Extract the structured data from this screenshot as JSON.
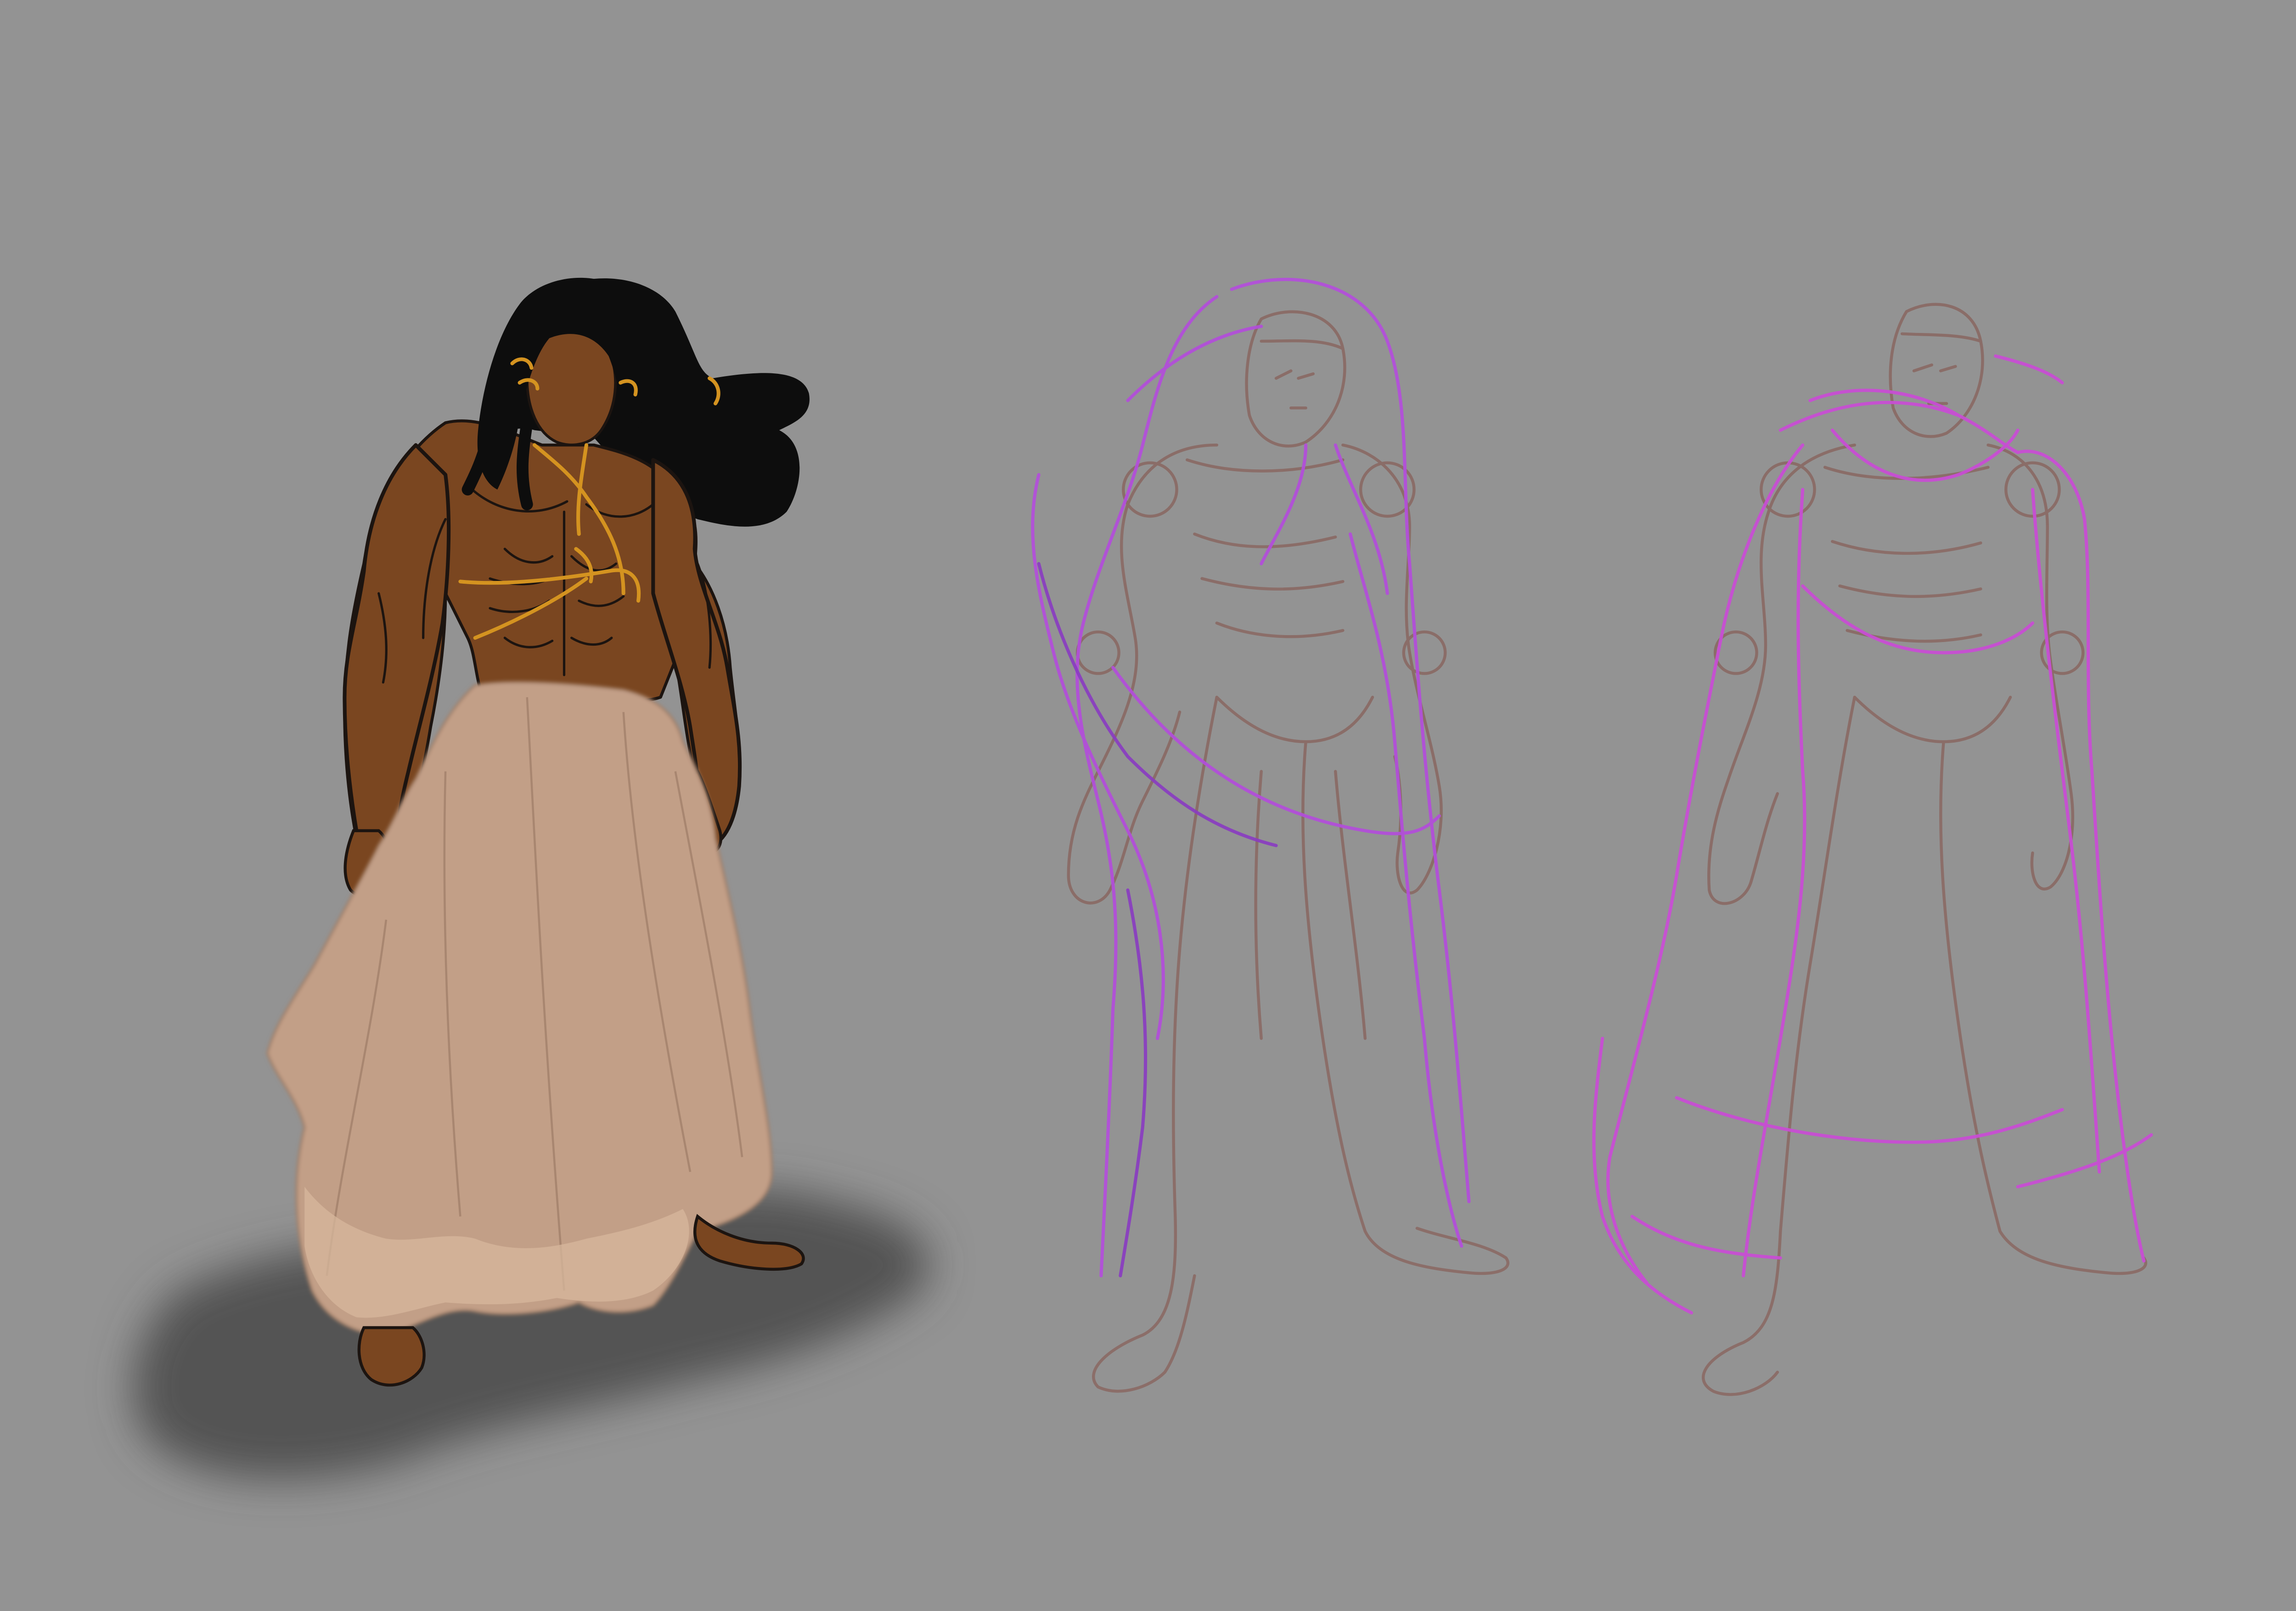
{
  "artwork": {
    "background_color": "#939393",
    "figures": [
      {
        "id": "colored-figure",
        "description_tag": "finished-figure",
        "colors": {
          "skin": "#7a4620",
          "skin_shadow": "#5c3214",
          "hair": "#0d0d0d",
          "cloth": "#c29f87",
          "cloth_light": "#d7b79c",
          "gold": "#d49320",
          "line": "#1c1410",
          "floor_shadow": "#4e4e4e"
        }
      },
      {
        "id": "sketch-figure-1",
        "colors": {
          "construction": "#8a6c66",
          "drapery": "#b24fd9",
          "drapery_dark": "#8a3bc2"
        }
      },
      {
        "id": "sketch-figure-2",
        "colors": {
          "construction": "#8a6c66",
          "cape": "#c84ed4"
        }
      }
    ]
  }
}
